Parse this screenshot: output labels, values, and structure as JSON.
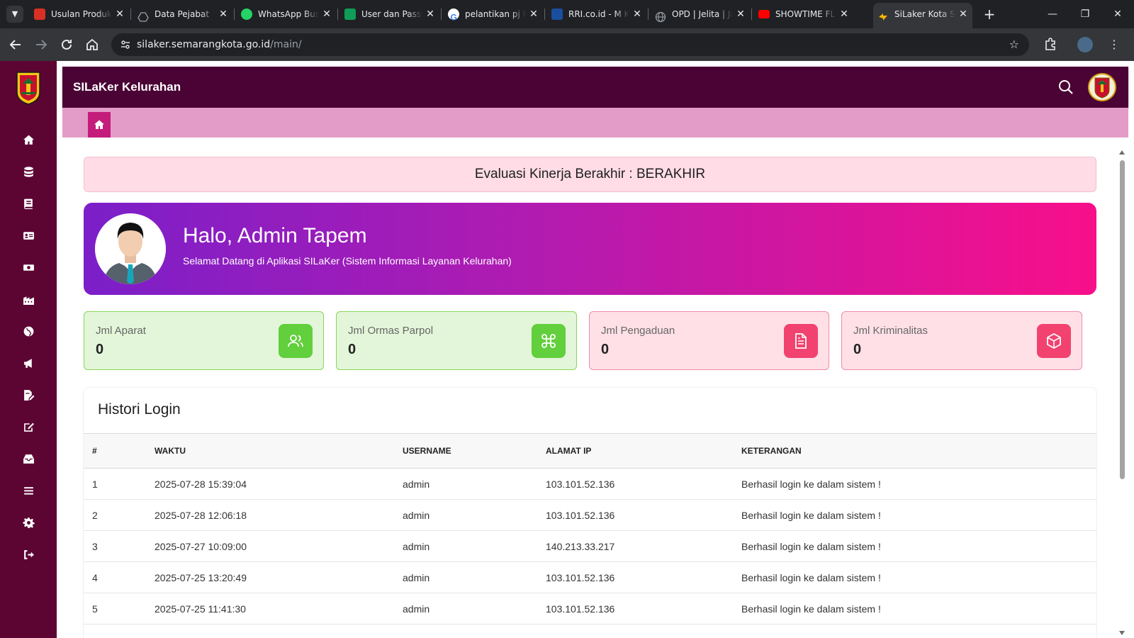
{
  "browser": {
    "tabs": [
      {
        "title": "Usulan Produk",
        "icon": "pdf-file-icon",
        "color": "#d93025"
      },
      {
        "title": "Data Pejabat",
        "icon": "google-drive-icon",
        "color": "#5f6368"
      },
      {
        "title": "WhatsApp Business",
        "icon": "whatsapp-icon",
        "color": "#25d366"
      },
      {
        "title": "User dan Password",
        "icon": "google-sheets-icon",
        "color": "#0f9d58"
      },
      {
        "title": "pelantikan pj k",
        "icon": "google-icon",
        "color": "#4285f4"
      },
      {
        "title": "RRI.co.id - M K",
        "icon": "rri-icon",
        "color": "#1a4fa0"
      },
      {
        "title": "OPD | Jelita | Ja",
        "icon": "globe-icon",
        "color": "#9aa0a6"
      },
      {
        "title": "SHOWTIME FL",
        "icon": "youtube-icon",
        "color": "#ff0000"
      },
      {
        "title": "SiLaker Kota Semarang",
        "icon": "silaker-icon",
        "color": "#f4b400"
      }
    ],
    "url_host": "silaker.semarangkota.go.id",
    "url_path": "/main/"
  },
  "app": {
    "brand": "SILaKer Kelurahan",
    "colors": {
      "sidebar": "#5c0533",
      "topbar": "#4a0334",
      "crumbbar": "#e39cc8",
      "accent": "#c41c7a"
    },
    "sidebar_items": [
      "home-icon",
      "database-icon",
      "book-icon",
      "id-card-icon",
      "money-icon",
      "building-icon",
      "globe-icon",
      "megaphone-icon",
      "file-signature-icon",
      "edit-icon",
      "inbox-icon",
      "list-icon",
      "settings-icon",
      "logout-icon"
    ]
  },
  "evaluation_banner": "Evaluasi Kinerja Berakhir : BERAKHIR",
  "hero": {
    "greeting": "Halo, Admin Tapem",
    "subtitle": "Selamat Datang di Aplikasi SILaKer (Sistem Informasi Layanan Kelurahan)"
  },
  "stats": [
    {
      "label": "Jml Aparat",
      "value": "0",
      "icon": "users-icon",
      "tone": "green"
    },
    {
      "label": "Jml Ormas Parpol",
      "value": "0",
      "icon": "command-icon",
      "tone": "green"
    },
    {
      "label": "Jml Pengaduan",
      "value": "0",
      "icon": "document-icon",
      "tone": "pink"
    },
    {
      "label": "Jml Kriminalitas",
      "value": "0",
      "icon": "box-icon",
      "tone": "pink"
    }
  ],
  "history": {
    "title": "Histori Login",
    "columns": [
      "#",
      "WAKTU",
      "USERNAME",
      "ALAMAT IP",
      "KETERANGAN"
    ],
    "rows": [
      [
        "1",
        "2025-07-28 15:39:04",
        "admin",
        "103.101.52.136",
        "Berhasil login ke dalam sistem !"
      ],
      [
        "2",
        "2025-07-28 12:06:18",
        "admin",
        "103.101.52.136",
        "Berhasil login ke dalam sistem !"
      ],
      [
        "3",
        "2025-07-27 10:09:00",
        "admin",
        "140.213.33.217",
        "Berhasil login ke dalam sistem !"
      ],
      [
        "4",
        "2025-07-25 13:20:49",
        "admin",
        "103.101.52.136",
        "Berhasil login ke dalam sistem !"
      ],
      [
        "5",
        "2025-07-25 11:41:30",
        "admin",
        "103.101.52.136",
        "Berhasil login ke dalam sistem !"
      ]
    ]
  }
}
